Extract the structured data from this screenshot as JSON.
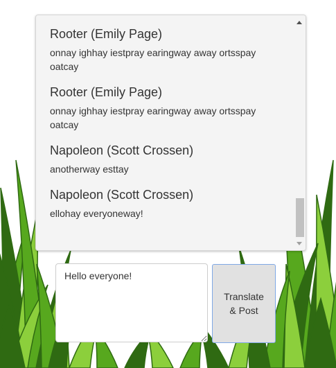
{
  "feed": {
    "messages": [
      {
        "author": "Rooter (Emily Page)",
        "text": "onnay ighhay iestpray earingway away ortsspay oatcay"
      },
      {
        "author": "Rooter (Emily Page)",
        "text": "onnay ighhay iestpray earingway away ortsspay oatcay"
      },
      {
        "author": "Napoleon (Scott Crossen)",
        "text": "anotherway esttay"
      },
      {
        "author": "Napoleon (Scott Crossen)",
        "text": "ellohay everyoneway!"
      }
    ]
  },
  "composer": {
    "input_value": "Hello everyone!",
    "button_label": "Translate & Post"
  },
  "colors": {
    "grass_dark": "#2f6a12",
    "grass_mid": "#57a81e",
    "grass_light": "#8ccf3c",
    "panel_bg": "#f4f4f4",
    "button_bg": "#e1e1e1",
    "button_border": "#7ea8e6"
  }
}
